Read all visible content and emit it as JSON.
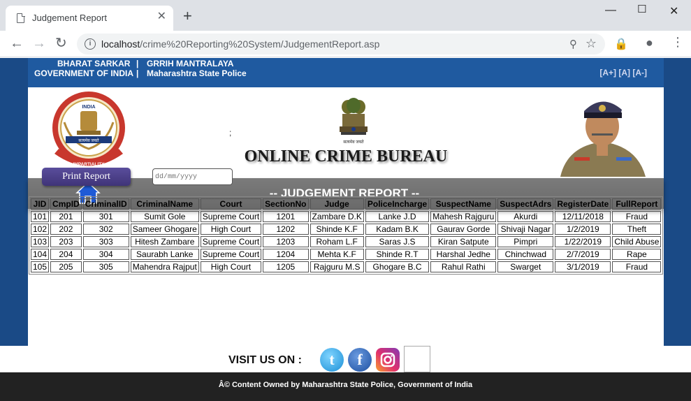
{
  "browser": {
    "tab_title": "Judgement Report",
    "new_tab": "+",
    "url_host": "localhost",
    "url_path": "/crime%20Reporting%20System/JudgementReport.asp"
  },
  "topbar": {
    "line1_left": "BHARAT SARKAR",
    "line2_left": "GOVERNMENT OF INDIA",
    "line1_right": "GRRIH MANTRALAYA",
    "line2_right": "Maharashtra State Police",
    "separator": "|",
    "font_controls": "[A+] [A] [A-]"
  },
  "banner": {
    "title": "ONLINE CRIME BUREAU",
    "semicolon": ";",
    "seal_text_top": "CENTRAL BUREAU OF INVESTIGATION",
    "seal_india": "INDIA",
    "seal_motto": "INDUSTRY  IMPARTIALITY  INTEGRITY"
  },
  "report": {
    "title": "-- JUDGEMENT REPORT --",
    "print_label": "Print Report",
    "date_placeholder": "dd/mm/yyyy"
  },
  "table": {
    "headers": [
      "JID",
      "CmpID",
      "CriminalID",
      "CriminalName",
      "Court",
      "SectionNo",
      "Judge",
      "PoliceIncharge",
      "SuspectName",
      "SuspectAdrs",
      "RegisterDate",
      "FullReport"
    ],
    "rows": [
      [
        "101",
        "201",
        "301",
        "Sumit Gole",
        "Supreme Court",
        "1201",
        "Zambare D.K",
        "Lanke J.D",
        "Mahesh Rajguru",
        "Akurdi",
        "12/11/2018",
        "Fraud"
      ],
      [
        "102",
        "202",
        "302",
        "Sameer Ghogare",
        "High Court",
        "1202",
        "Shinde K.F",
        "Kadam B.K",
        "Gaurav Gorde",
        "Shivaji Nagar",
        "1/2/2019",
        "Theft"
      ],
      [
        "103",
        "203",
        "303",
        "Hitesh Zambare",
        "Supreme Court",
        "1203",
        "Roham L.F",
        "Saras J.S",
        "Kiran Satpute",
        "Pimpri",
        "1/22/2019",
        "Child Abuse"
      ],
      [
        "104",
        "204",
        "304",
        "Saurabh Lanke",
        "Supreme Court",
        "1204",
        "Mehta K.F",
        "Shinde R.T",
        "Harshal Jedhe",
        "Chinchwad",
        "2/7/2019",
        "Rape"
      ],
      [
        "105",
        "205",
        "305",
        "Mahendra Rajput",
        "High Court",
        "1205",
        "Rajguru M.S",
        "Ghogare B.C",
        "Rahul Rathi",
        "Swarget",
        "3/1/2019",
        "Fraud"
      ]
    ]
  },
  "social": {
    "label": "VISIT US ON :",
    "twitter_glyph": "t",
    "facebook_glyph": "f"
  },
  "footer": {
    "text": "Â© Content Owned by Maharashtra State Police, Government of India"
  }
}
